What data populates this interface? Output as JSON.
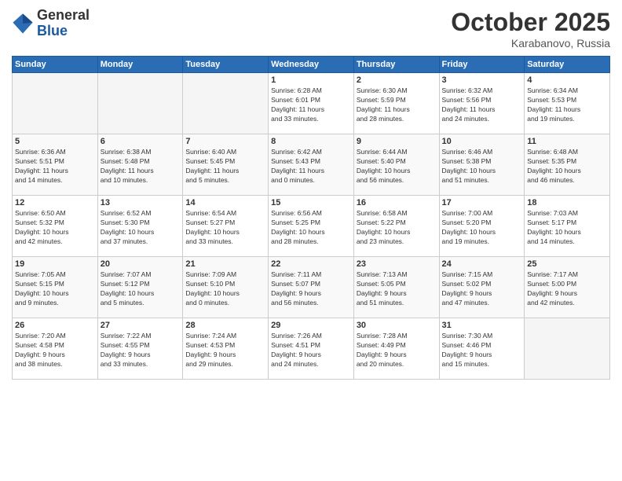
{
  "logo": {
    "general": "General",
    "blue": "Blue"
  },
  "title": "October 2025",
  "subtitle": "Karabanovo, Russia",
  "weekdays": [
    "Sunday",
    "Monday",
    "Tuesday",
    "Wednesday",
    "Thursday",
    "Friday",
    "Saturday"
  ],
  "weeks": [
    [
      {
        "num": "",
        "info": ""
      },
      {
        "num": "",
        "info": ""
      },
      {
        "num": "",
        "info": ""
      },
      {
        "num": "1",
        "info": "Sunrise: 6:28 AM\nSunset: 6:01 PM\nDaylight: 11 hours\nand 33 minutes."
      },
      {
        "num": "2",
        "info": "Sunrise: 6:30 AM\nSunset: 5:59 PM\nDaylight: 11 hours\nand 28 minutes."
      },
      {
        "num": "3",
        "info": "Sunrise: 6:32 AM\nSunset: 5:56 PM\nDaylight: 11 hours\nand 24 minutes."
      },
      {
        "num": "4",
        "info": "Sunrise: 6:34 AM\nSunset: 5:53 PM\nDaylight: 11 hours\nand 19 minutes."
      }
    ],
    [
      {
        "num": "5",
        "info": "Sunrise: 6:36 AM\nSunset: 5:51 PM\nDaylight: 11 hours\nand 14 minutes."
      },
      {
        "num": "6",
        "info": "Sunrise: 6:38 AM\nSunset: 5:48 PM\nDaylight: 11 hours\nand 10 minutes."
      },
      {
        "num": "7",
        "info": "Sunrise: 6:40 AM\nSunset: 5:45 PM\nDaylight: 11 hours\nand 5 minutes."
      },
      {
        "num": "8",
        "info": "Sunrise: 6:42 AM\nSunset: 5:43 PM\nDaylight: 11 hours\nand 0 minutes."
      },
      {
        "num": "9",
        "info": "Sunrise: 6:44 AM\nSunset: 5:40 PM\nDaylight: 10 hours\nand 56 minutes."
      },
      {
        "num": "10",
        "info": "Sunrise: 6:46 AM\nSunset: 5:38 PM\nDaylight: 10 hours\nand 51 minutes."
      },
      {
        "num": "11",
        "info": "Sunrise: 6:48 AM\nSunset: 5:35 PM\nDaylight: 10 hours\nand 46 minutes."
      }
    ],
    [
      {
        "num": "12",
        "info": "Sunrise: 6:50 AM\nSunset: 5:32 PM\nDaylight: 10 hours\nand 42 minutes."
      },
      {
        "num": "13",
        "info": "Sunrise: 6:52 AM\nSunset: 5:30 PM\nDaylight: 10 hours\nand 37 minutes."
      },
      {
        "num": "14",
        "info": "Sunrise: 6:54 AM\nSunset: 5:27 PM\nDaylight: 10 hours\nand 33 minutes."
      },
      {
        "num": "15",
        "info": "Sunrise: 6:56 AM\nSunset: 5:25 PM\nDaylight: 10 hours\nand 28 minutes."
      },
      {
        "num": "16",
        "info": "Sunrise: 6:58 AM\nSunset: 5:22 PM\nDaylight: 10 hours\nand 23 minutes."
      },
      {
        "num": "17",
        "info": "Sunrise: 7:00 AM\nSunset: 5:20 PM\nDaylight: 10 hours\nand 19 minutes."
      },
      {
        "num": "18",
        "info": "Sunrise: 7:03 AM\nSunset: 5:17 PM\nDaylight: 10 hours\nand 14 minutes."
      }
    ],
    [
      {
        "num": "19",
        "info": "Sunrise: 7:05 AM\nSunset: 5:15 PM\nDaylight: 10 hours\nand 9 minutes."
      },
      {
        "num": "20",
        "info": "Sunrise: 7:07 AM\nSunset: 5:12 PM\nDaylight: 10 hours\nand 5 minutes."
      },
      {
        "num": "21",
        "info": "Sunrise: 7:09 AM\nSunset: 5:10 PM\nDaylight: 10 hours\nand 0 minutes."
      },
      {
        "num": "22",
        "info": "Sunrise: 7:11 AM\nSunset: 5:07 PM\nDaylight: 9 hours\nand 56 minutes."
      },
      {
        "num": "23",
        "info": "Sunrise: 7:13 AM\nSunset: 5:05 PM\nDaylight: 9 hours\nand 51 minutes."
      },
      {
        "num": "24",
        "info": "Sunrise: 7:15 AM\nSunset: 5:02 PM\nDaylight: 9 hours\nand 47 minutes."
      },
      {
        "num": "25",
        "info": "Sunrise: 7:17 AM\nSunset: 5:00 PM\nDaylight: 9 hours\nand 42 minutes."
      }
    ],
    [
      {
        "num": "26",
        "info": "Sunrise: 7:20 AM\nSunset: 4:58 PM\nDaylight: 9 hours\nand 38 minutes."
      },
      {
        "num": "27",
        "info": "Sunrise: 7:22 AM\nSunset: 4:55 PM\nDaylight: 9 hours\nand 33 minutes."
      },
      {
        "num": "28",
        "info": "Sunrise: 7:24 AM\nSunset: 4:53 PM\nDaylight: 9 hours\nand 29 minutes."
      },
      {
        "num": "29",
        "info": "Sunrise: 7:26 AM\nSunset: 4:51 PM\nDaylight: 9 hours\nand 24 minutes."
      },
      {
        "num": "30",
        "info": "Sunrise: 7:28 AM\nSunset: 4:49 PM\nDaylight: 9 hours\nand 20 minutes."
      },
      {
        "num": "31",
        "info": "Sunrise: 7:30 AM\nSunset: 4:46 PM\nDaylight: 9 hours\nand 15 minutes."
      },
      {
        "num": "",
        "info": ""
      }
    ]
  ]
}
